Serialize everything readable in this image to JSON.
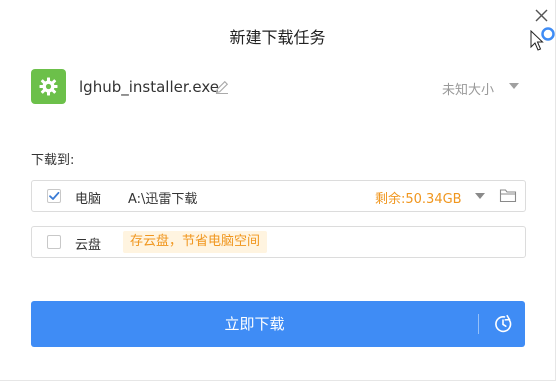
{
  "dialog": {
    "title": "新建下载任务"
  },
  "file": {
    "name": "lghub_installer.exe",
    "size": "未知大小",
    "icon": "android-gear-icon"
  },
  "save_to": {
    "label": "下载到:",
    "options": [
      {
        "label": "电脑",
        "checked": true,
        "path": "A:\\迅雷下载",
        "free_space": "剩余:50.34GB"
      },
      {
        "label": "云盘",
        "checked": false,
        "tip": "存云盘，节省电脑空间"
      }
    ]
  },
  "actions": {
    "download": "立即下载"
  },
  "colors": {
    "primary": "#3f8cf5",
    "accent_orange": "#f0961e",
    "file_icon_green": "#6cc04a",
    "check_blue": "#3a7bd5"
  }
}
